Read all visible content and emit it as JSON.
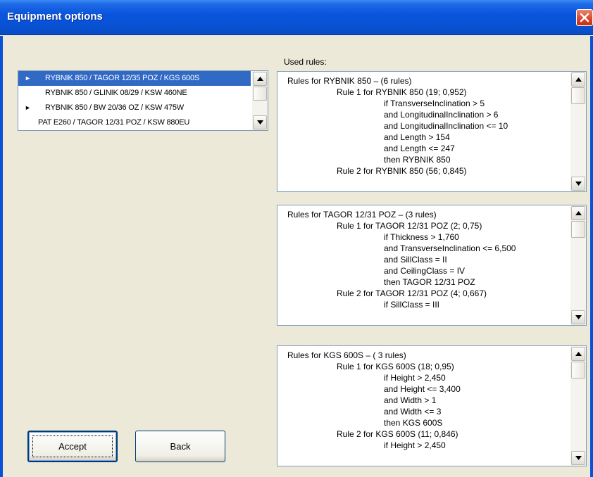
{
  "window": {
    "title": "Equipment options",
    "close_icon": "close-icon"
  },
  "list": {
    "items": [
      {
        "marker": "►",
        "label": "RYBNIK 850 / TAGOR 12/35 POZ / KGS 600S",
        "selected": true
      },
      {
        "marker": "",
        "label": "RYBNIK 850 / GLINIK 08/29 / KSW 460NE",
        "selected": false
      },
      {
        "marker": "►",
        "label": "RYBNIK 850 / BW 20/36 OZ / KSW 475W",
        "selected": false
      },
      {
        "marker": "",
        "label": "PAT E260 / TAGOR 12/31 POZ / KSW 880EU",
        "selected": false
      }
    ]
  },
  "used_rules_label": "Used rules:",
  "panels": [
    {
      "lines": [
        "Rules for RYBNIK 850 – (6 rules)",
        "Rule 1 for  RYBNIK 850 (19; 0,952)",
        "if TransverseInclination > 5",
        "and LongitudinalInclination > 6",
        "and LongitudinalInclination <= 10",
        "and Length > 154",
        "and Length <= 247",
        "then RYBNIK 850",
        "Rule 2 for  RYBNIK 850 (56; 0,845)"
      ]
    },
    {
      "lines": [
        "Rules  for TAGOR 12/31 POZ – (3 rules)",
        "Rule 1 for  TAGOR 12/31 POZ (2; 0,75)",
        "if Thickness > 1,760",
        "and TransverseInclination <= 6,500",
        "and SillClass = II",
        "and CeilingClass = IV",
        "then TAGOR 12/31 POZ",
        "Rule 2 for  TAGOR 12/31 POZ (4; 0,667)",
        "if SillClass = III"
      ]
    },
    {
      "lines": [
        "Rules  for KGS 600S – ( 3 rules)",
        "Rule 1 for  KGS 600S (18; 0,95)",
        "if Height > 2,450",
        "and Height <= 3,400",
        "and Width > 1",
        "and Width <= 3",
        "then KGS 600S",
        "Rule 2 for  KGS 600S (11; 0,846)",
        "if Height > 2,450"
      ]
    }
  ],
  "buttons": {
    "accept": "Accept",
    "back": "Back"
  }
}
